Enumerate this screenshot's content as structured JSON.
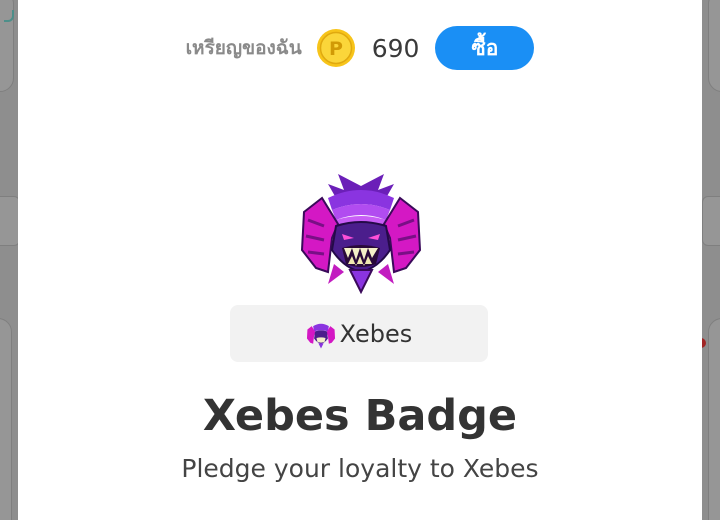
{
  "wallet": {
    "label": "เหรียญของฉัน",
    "coin_icon": "coin-icon",
    "coin_letter": "P",
    "coin_count": "690",
    "buy_label": "ซื้อ"
  },
  "badge": {
    "art_icon": "demon-mask-icon",
    "name": "Xebes",
    "title": "Xebes Badge",
    "description": "Pledge your loyalty to Xebes"
  },
  "colors": {
    "accent": "#1a8ff5",
    "coin": "#f5c518",
    "chip_bg": "#f2f2f2",
    "text": "#333333",
    "badge_purple": "#7a2fd0",
    "badge_magenta": "#e020c8"
  }
}
